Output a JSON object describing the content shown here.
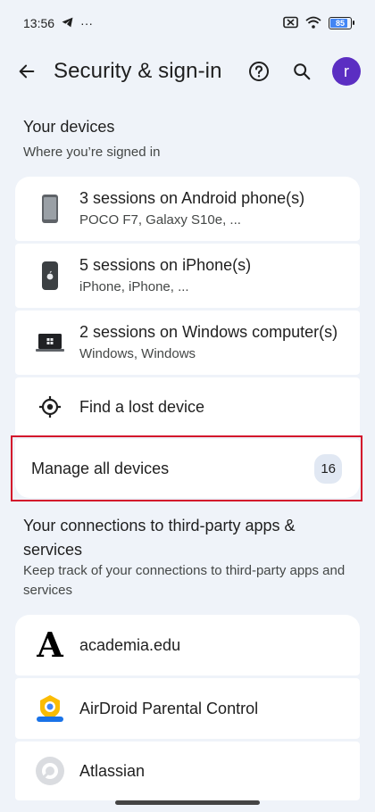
{
  "status_bar": {
    "time": "13:56",
    "dots": "···",
    "battery": "85",
    "battery_level": 0.85
  },
  "app_bar": {
    "title": "Security & sign-in",
    "avatar_letter": "r",
    "avatar_color": "#5b2ec2"
  },
  "devices_section": {
    "title": "Your devices",
    "subtitle": "Where you’re signed in",
    "items": [
      {
        "icon": "android-phone-icon",
        "title": "3 sessions on Android phone(s)",
        "subtitle": "POCO F7, Galaxy S10e, ..."
      },
      {
        "icon": "iphone-icon",
        "title": "5 sessions on iPhone(s)",
        "subtitle": "iPhone, iPhone, ..."
      },
      {
        "icon": "windows-laptop-icon",
        "title": "2 sessions on Windows computer(s)",
        "subtitle": "Windows, Windows"
      },
      {
        "icon": "locate-icon",
        "title": "Find a lost device"
      }
    ],
    "manage": {
      "label": "Manage all devices",
      "count": "16"
    }
  },
  "connections_section": {
    "title": "Your connections to third-party apps & services",
    "subtitle": "Keep track of your connections to third-party apps and services",
    "apps": [
      {
        "icon": "academia-logo-icon",
        "logo_letter": "A",
        "name": "academia.edu"
      },
      {
        "icon": "airdroid-logo-icon",
        "name": "AirDroid Parental Control"
      },
      {
        "icon": "atlassian-logo-icon",
        "name": "Atlassian"
      }
    ]
  },
  "colors": {
    "background": "#eff3f9",
    "card": "#ffffff",
    "highlight": "#d3122b",
    "badge": "#e1e8f3"
  }
}
